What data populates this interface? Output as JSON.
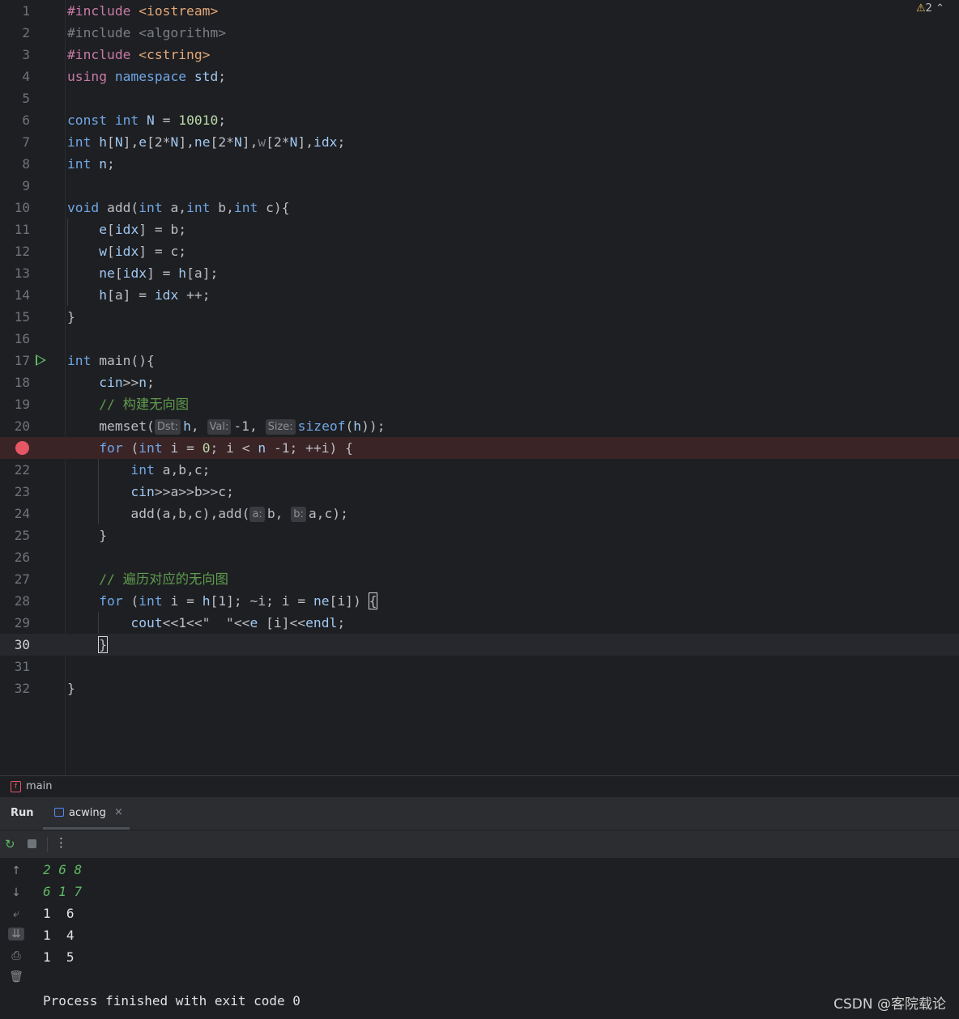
{
  "editor": {
    "warning_count": "2",
    "lines": [
      {
        "n": "1",
        "tokens": [
          [
            "inc",
            "#include "
          ],
          [
            "incf",
            "<iostream>"
          ]
        ]
      },
      {
        "n": "2",
        "tokens": [
          [
            "dim",
            "#include <algorithm>"
          ]
        ]
      },
      {
        "n": "3",
        "tokens": [
          [
            "inc",
            "#include "
          ],
          [
            "incf",
            "<cstring>"
          ]
        ]
      },
      {
        "n": "4",
        "tokens": [
          [
            "inc",
            "using "
          ],
          [
            "kw",
            "namespace "
          ],
          [
            "var",
            "std"
          ],
          [
            "",
            "; "
          ]
        ]
      },
      {
        "n": "5",
        "tokens": []
      },
      {
        "n": "6",
        "tokens": [
          [
            "kw",
            "const int "
          ],
          [
            "var",
            "N"
          ],
          [
            "",
            " = "
          ],
          [
            "num2",
            "10010"
          ],
          [
            "",
            ";"
          ]
        ]
      },
      {
        "n": "7",
        "tokens": [
          [
            "kw",
            "int "
          ],
          [
            "var",
            "h"
          ],
          [
            "",
            "["
          ],
          [
            "var",
            "N"
          ],
          [
            "",
            "],"
          ],
          [
            "var",
            "e"
          ],
          [
            "",
            "[2*"
          ],
          [
            "var",
            "N"
          ],
          [
            "",
            "],"
          ],
          [
            "var",
            "ne"
          ],
          [
            "",
            "[2*"
          ],
          [
            "var",
            "N"
          ],
          [
            "",
            "],"
          ],
          [
            "dim",
            "w"
          ],
          [
            "",
            "[2*"
          ],
          [
            "var",
            "N"
          ],
          [
            "",
            "],"
          ],
          [
            "var",
            "idx"
          ],
          [
            "",
            ";"
          ]
        ]
      },
      {
        "n": "8",
        "tokens": [
          [
            "kw",
            "int "
          ],
          [
            "var",
            "n"
          ],
          [
            "",
            ";"
          ]
        ]
      },
      {
        "n": "9",
        "tokens": []
      },
      {
        "n": "10",
        "tokens": [
          [
            "kw",
            "void "
          ],
          [
            "",
            "add("
          ],
          [
            "kw",
            "int "
          ],
          [
            "",
            "a,"
          ],
          [
            "kw",
            "int "
          ],
          [
            "",
            "b,"
          ],
          [
            "kw",
            "int "
          ],
          [
            "",
            "c){"
          ]
        ]
      },
      {
        "n": "11",
        "tokens": [
          [
            "",
            "    "
          ],
          [
            "var",
            "e"
          ],
          [
            "",
            "["
          ],
          [
            "var",
            "idx"
          ],
          [
            "",
            "] = b;"
          ]
        ]
      },
      {
        "n": "12",
        "tokens": [
          [
            "",
            "    "
          ],
          [
            "var",
            "w"
          ],
          [
            "",
            "["
          ],
          [
            "var",
            "idx"
          ],
          [
            "",
            "] = c;"
          ]
        ]
      },
      {
        "n": "13",
        "tokens": [
          [
            "",
            "    "
          ],
          [
            "var",
            "ne"
          ],
          [
            "",
            "["
          ],
          [
            "var",
            "idx"
          ],
          [
            "",
            "] = "
          ],
          [
            "var",
            "h"
          ],
          [
            "",
            "[a];"
          ]
        ]
      },
      {
        "n": "14",
        "tokens": [
          [
            "",
            "    "
          ],
          [
            "var",
            "h"
          ],
          [
            "",
            "[a] = "
          ],
          [
            "var",
            "idx"
          ],
          [
            "",
            " ++;"
          ]
        ]
      },
      {
        "n": "15",
        "tokens": [
          [
            "",
            "}"
          ]
        ]
      },
      {
        "n": "16",
        "tokens": []
      },
      {
        "n": "17",
        "tokens": [
          [
            "kw",
            "int "
          ],
          [
            "",
            "main(){"
          ]
        ]
      },
      {
        "n": "18",
        "tokens": [
          [
            "",
            "    "
          ],
          [
            "var",
            "cin"
          ],
          [
            "",
            ">>"
          ],
          [
            "var",
            "n"
          ],
          [
            "",
            ";"
          ]
        ]
      },
      {
        "n": "19",
        "tokens": [
          [
            "",
            "    "
          ],
          [
            "cmt",
            "// 构建无向图"
          ]
        ]
      },
      {
        "n": "20",
        "tokens": [
          [
            "",
            "    memset("
          ],
          [
            "hint",
            "Dst:"
          ],
          [
            "var",
            "h"
          ],
          [
            "",
            ", "
          ],
          [
            "hint",
            "Val:"
          ],
          [
            "",
            "-1, "
          ],
          [
            "hint",
            "Size:"
          ],
          [
            "kw",
            "sizeof"
          ],
          [
            "",
            "("
          ],
          [
            "var",
            "h"
          ],
          [
            "",
            "));"
          ]
        ]
      },
      {
        "n": "21",
        "tokens": [
          [
            "",
            "    "
          ],
          [
            "kw",
            "for "
          ],
          [
            "",
            "("
          ],
          [
            "kw",
            "int "
          ],
          [
            "",
            "i = "
          ],
          [
            "num2",
            "0"
          ],
          [
            "",
            "; i < "
          ],
          [
            "var",
            "n"
          ],
          [
            "",
            " -1; ++i) {"
          ]
        ]
      },
      {
        "n": "22",
        "tokens": [
          [
            "",
            "        "
          ],
          [
            "kw",
            "int "
          ],
          [
            "",
            "a,b,c;"
          ]
        ]
      },
      {
        "n": "23",
        "tokens": [
          [
            "",
            "        "
          ],
          [
            "var",
            "cin"
          ],
          [
            "",
            ">>a>>b>>c;"
          ]
        ]
      },
      {
        "n": "24",
        "tokens": [
          [
            "",
            "        add(a,b,c),add("
          ],
          [
            "hint",
            "a:"
          ],
          [
            "",
            "b, "
          ],
          [
            "hint",
            "b:"
          ],
          [
            "",
            "a,c);"
          ]
        ]
      },
      {
        "n": "25",
        "tokens": [
          [
            "",
            "    }"
          ]
        ]
      },
      {
        "n": "26",
        "tokens": []
      },
      {
        "n": "27",
        "tokens": [
          [
            "",
            "    "
          ],
          [
            "cmt",
            "// 遍历对应的无向图"
          ]
        ]
      },
      {
        "n": "28",
        "tokens": [
          [
            "",
            "    "
          ],
          [
            "kw",
            "for "
          ],
          [
            "",
            "("
          ],
          [
            "kw",
            "int "
          ],
          [
            "",
            "i = "
          ],
          [
            "var",
            "h"
          ],
          [
            "",
            "[1]; ~i; i = "
          ],
          [
            "var",
            "ne"
          ],
          [
            "",
            "[i]) "
          ],
          [
            "caret",
            "{"
          ]
        ]
      },
      {
        "n": "29",
        "tokens": [
          [
            "",
            "        "
          ],
          [
            "var",
            "cout"
          ],
          [
            "",
            "<<1<<\"  \"<<"
          ],
          [
            "var",
            "e"
          ],
          [
            "",
            " [i]<<"
          ],
          [
            "var",
            "endl"
          ],
          [
            "",
            ";"
          ]
        ]
      },
      {
        "n": "30",
        "tokens": [
          [
            "",
            "    "
          ],
          [
            "caret",
            "}"
          ]
        ]
      },
      {
        "n": "31",
        "tokens": []
      },
      {
        "n": "32",
        "tokens": [
          [
            "",
            "}"
          ]
        ]
      }
    ]
  },
  "breadcrumb": {
    "icon": "f",
    "label": "main"
  },
  "run_panel": {
    "title": "Run",
    "tab_label": "acwing",
    "tab_close": "×"
  },
  "console": {
    "lines": [
      {
        "text": "2 6 8",
        "type": "input"
      },
      {
        "text": "6 1 7",
        "type": "input"
      },
      {
        "text": "1  6",
        "type": "output"
      },
      {
        "text": "1  4",
        "type": "output"
      },
      {
        "text": "1  5",
        "type": "output"
      },
      {
        "text": "",
        "type": "output"
      },
      {
        "text": "Process finished with exit code 0",
        "type": "output"
      }
    ]
  },
  "watermark": "CSDN @客院载论"
}
